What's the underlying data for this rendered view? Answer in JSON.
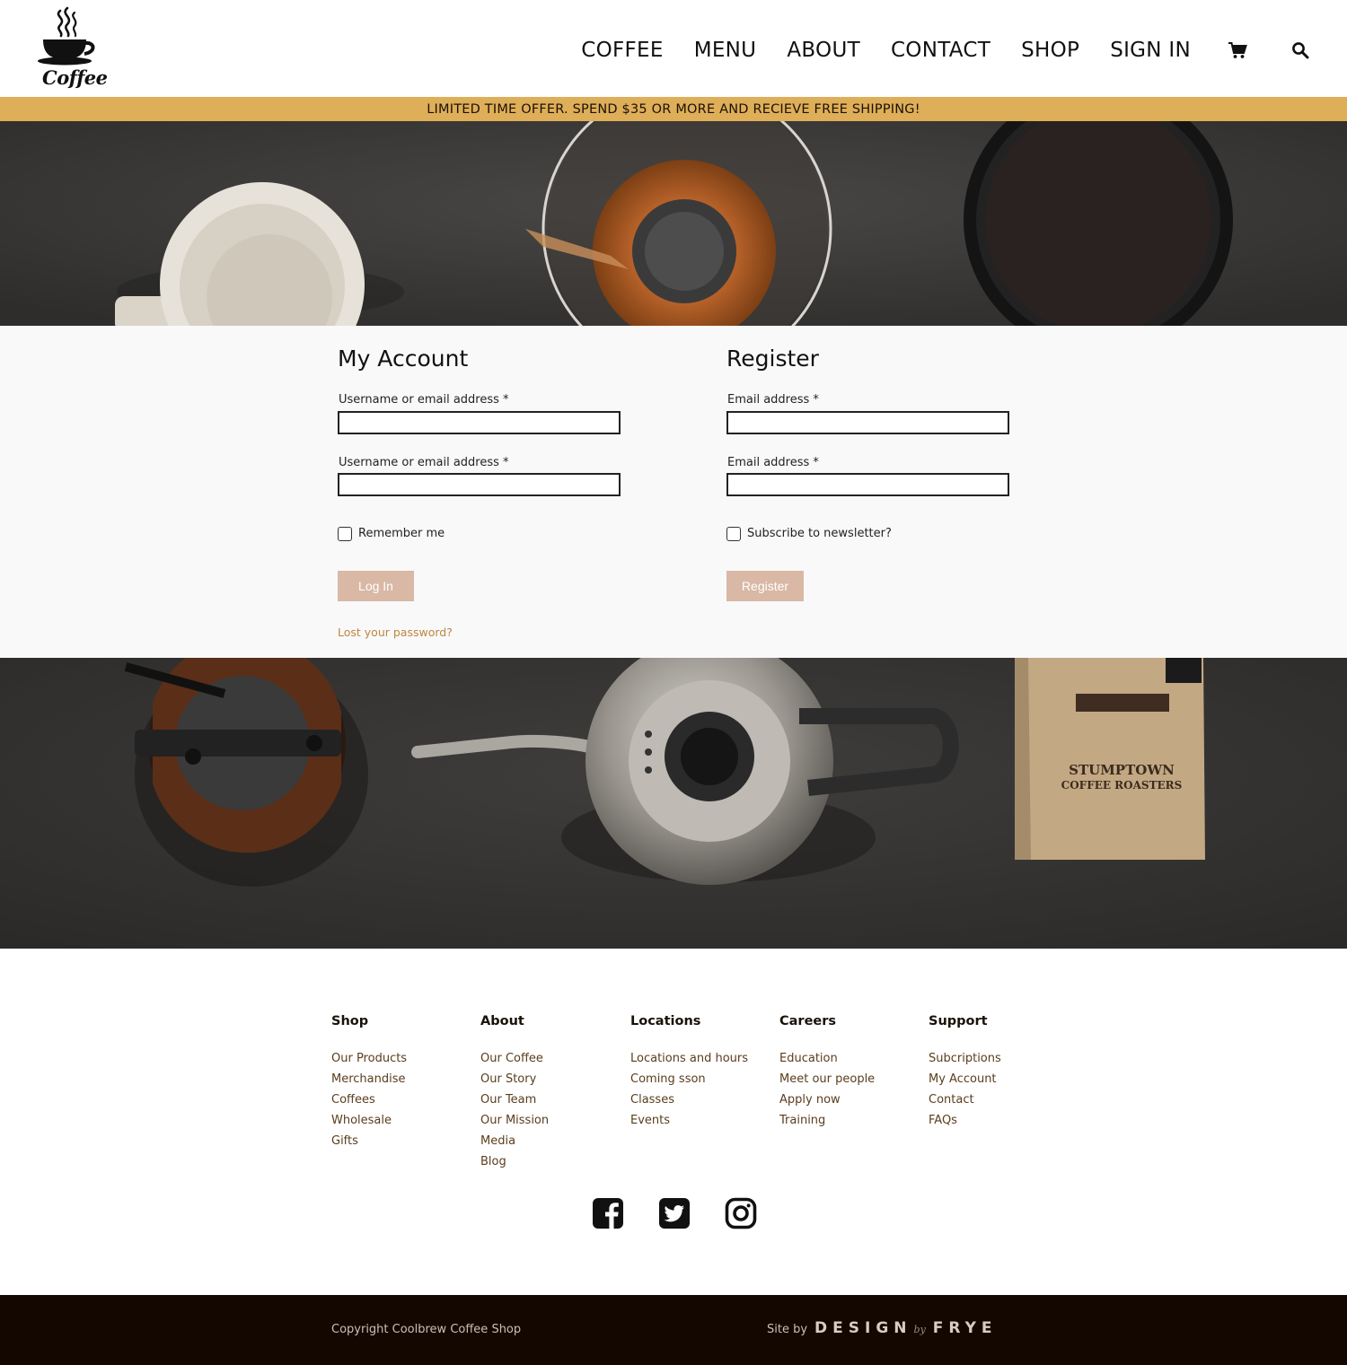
{
  "brand": {
    "logo_text": "Coffee"
  },
  "nav": {
    "items": [
      "COFFEE",
      "MENU",
      "ABOUT",
      "CONTACT",
      "SHOP",
      "SIGN IN"
    ],
    "cart_icon": "cart-icon",
    "search_icon": "search-icon"
  },
  "promo": {
    "text": "LIMITED TIME OFFER. SPEND $35 OR MORE AND RECIEVE FREE SHIPPING!"
  },
  "hero_bottom": {
    "bag_line1": "STUMPTOWN",
    "bag_line2": "COFFEE ROASTERS"
  },
  "login": {
    "title": "My Account",
    "field1_label": "Username or email address *",
    "field1_value": "",
    "field2_label": "Username or email address *",
    "field2_value": "",
    "checkbox_label": "Remember me",
    "checkbox_checked": false,
    "button_label": "Log In",
    "lost_password": "Lost your password?"
  },
  "register": {
    "title": "Register",
    "field1_label": "Email address *",
    "field1_value": "",
    "field2_label": "Email address *",
    "field2_value": "",
    "checkbox_label": "Subscribe to newsletter?",
    "checkbox_checked": false,
    "button_label": "Register"
  },
  "footer": {
    "columns": [
      {
        "title": "Shop",
        "links": [
          "Our Products",
          "Merchandise",
          "Coffees",
          "Wholesale",
          "Gifts"
        ]
      },
      {
        "title": "About",
        "links": [
          "Our Coffee",
          "Our Story",
          "Our Team",
          "Our Mission",
          "Media",
          "Blog"
        ]
      },
      {
        "title": "Locations",
        "links": [
          "Locations and hours",
          "Coming sson",
          "Classes",
          "Events"
        ]
      },
      {
        "title": "Careers",
        "links": [
          "Education",
          "Meet our people",
          "Apply now",
          "Training"
        ]
      },
      {
        "title": "Support",
        "links": [
          "Subcriptions",
          "My Account",
          "Contact",
          "FAQs"
        ]
      }
    ],
    "social": [
      "facebook-icon",
      "twitter-icon",
      "instagram-icon"
    ]
  },
  "bottom": {
    "copyright": "Copyright Coolbrew Coffee Shop",
    "site_by": "Site by",
    "brand_part1": "DESIGN",
    "brand_by": "by",
    "brand_part2": "FRYE"
  },
  "colors": {
    "promo_bg": "#dfae58",
    "button_bg": "#d9b8a6",
    "link_accent": "#bd8642",
    "bottom_bar": "#140700"
  }
}
